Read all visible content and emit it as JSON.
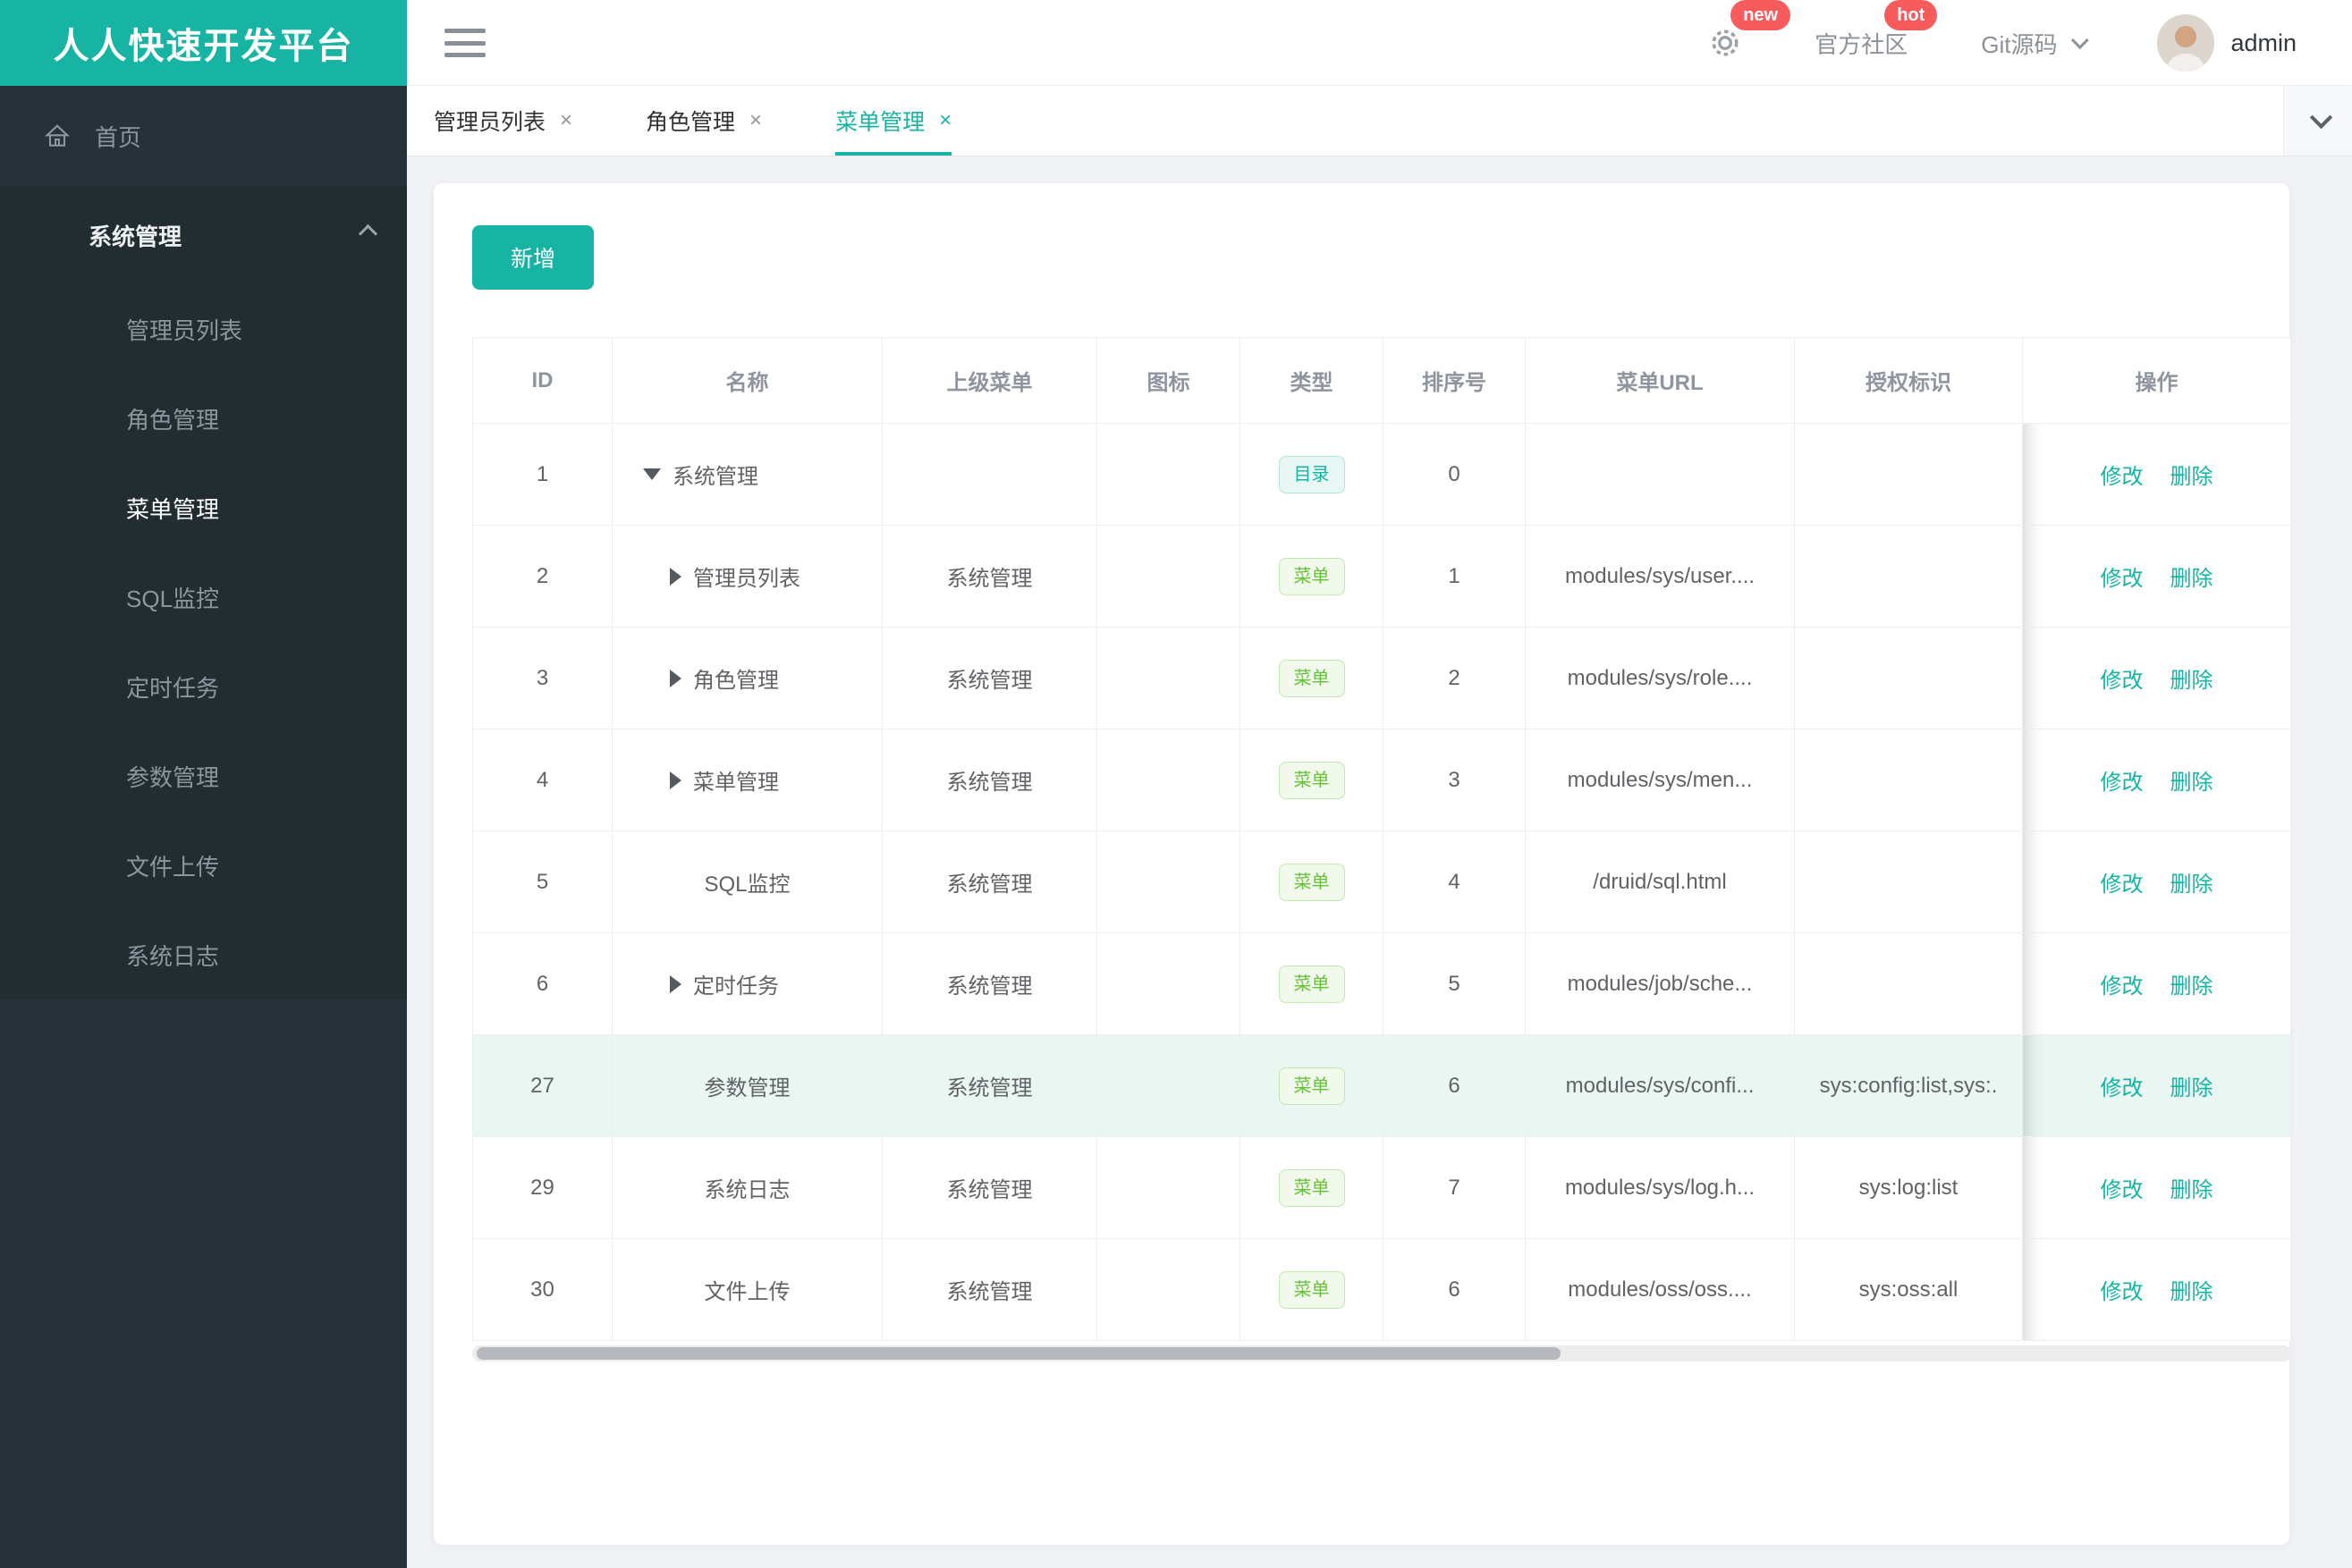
{
  "brand": {
    "title": "人人快速开发平台"
  },
  "header": {
    "settings": {
      "badge": "new"
    },
    "community": {
      "label": "官方社区",
      "badge": "hot"
    },
    "git": {
      "label": "Git源码"
    },
    "user": {
      "name": "admin"
    }
  },
  "tabs": [
    {
      "label": "管理员列表",
      "close": "×",
      "active": false
    },
    {
      "label": "角色管理",
      "close": "×",
      "active": false
    },
    {
      "label": "菜单管理",
      "close": "×",
      "active": true
    }
  ],
  "sidebar": {
    "home": {
      "label": "首页"
    },
    "group": {
      "label": "系统管理",
      "items": [
        {
          "label": "管理员列表",
          "active": false
        },
        {
          "label": "角色管理",
          "active": false
        },
        {
          "label": "菜单管理",
          "active": true
        },
        {
          "label": "SQL监控",
          "active": false
        },
        {
          "label": "定时任务",
          "active": false
        },
        {
          "label": "参数管理",
          "active": false
        },
        {
          "label": "文件上传",
          "active": false
        },
        {
          "label": "系统日志",
          "active": false
        }
      ]
    }
  },
  "toolbar": {
    "add_label": "新增"
  },
  "table": {
    "headers": [
      "ID",
      "名称",
      "上级菜单",
      "图标",
      "类型",
      "排序号",
      "菜单URL",
      "授权标识",
      "操作"
    ],
    "actions": {
      "edit": "修改",
      "delete": "删除"
    },
    "rows": [
      {
        "id": "1",
        "arrow": "down",
        "name": "系统管理",
        "parent": "",
        "type_label": "目录",
        "type_kind": "dir",
        "order": "0",
        "url": "",
        "perms": "",
        "highlight": false
      },
      {
        "id": "2",
        "arrow": "right",
        "name": "管理员列表",
        "parent": "系统管理",
        "type_label": "菜单",
        "type_kind": "menu",
        "order": "1",
        "url": "modules/sys/user....",
        "perms": "",
        "highlight": false
      },
      {
        "id": "3",
        "arrow": "right",
        "name": "角色管理",
        "parent": "系统管理",
        "type_label": "菜单",
        "type_kind": "menu",
        "order": "2",
        "url": "modules/sys/role....",
        "perms": "",
        "highlight": false
      },
      {
        "id": "4",
        "arrow": "right",
        "name": "菜单管理",
        "parent": "系统管理",
        "type_label": "菜单",
        "type_kind": "menu",
        "order": "3",
        "url": "modules/sys/men...",
        "perms": "",
        "highlight": false
      },
      {
        "id": "5",
        "arrow": "none",
        "name": "SQL监控",
        "parent": "系统管理",
        "type_label": "菜单",
        "type_kind": "menu",
        "order": "4",
        "url": "/druid/sql.html",
        "perms": "",
        "highlight": false
      },
      {
        "id": "6",
        "arrow": "right",
        "name": "定时任务",
        "parent": "系统管理",
        "type_label": "菜单",
        "type_kind": "menu",
        "order": "5",
        "url": "modules/job/sche...",
        "perms": "",
        "highlight": false
      },
      {
        "id": "27",
        "arrow": "none",
        "name": "参数管理",
        "parent": "系统管理",
        "type_label": "菜单",
        "type_kind": "menu",
        "order": "6",
        "url": "modules/sys/confi...",
        "perms": "sys:config:list,sys:.",
        "highlight": true
      },
      {
        "id": "29",
        "arrow": "none",
        "name": "系统日志",
        "parent": "系统管理",
        "type_label": "菜单",
        "type_kind": "menu",
        "order": "7",
        "url": "modules/sys/log.h...",
        "perms": "sys:log:list",
        "highlight": false
      },
      {
        "id": "30",
        "arrow": "none",
        "name": "文件上传",
        "parent": "系统管理",
        "type_label": "菜单",
        "type_kind": "menu",
        "order": "6",
        "url": "modules/oss/oss....",
        "perms": "sys:oss:all",
        "highlight": false
      }
    ]
  },
  "colors": {
    "primary": "#17b3a3",
    "badge_red": "#f85b5b",
    "tag_green": "#67c23a",
    "highlight_row": "#e9f6f2",
    "sidebar_bg": "#263238",
    "sidebar_group_bg": "#222d32"
  }
}
